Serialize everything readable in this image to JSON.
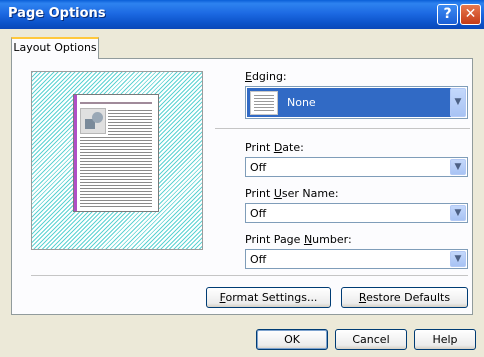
{
  "window": {
    "title": "Page Options",
    "help_glyph": "?",
    "close_glyph": "✕"
  },
  "tabs": [
    {
      "label": "Layout Options"
    }
  ],
  "edging": {
    "label_first": "E",
    "label_rest": "dging:",
    "value": "None"
  },
  "print_date": {
    "label_pre": "Print ",
    "label_key": "D",
    "label_rest": "ate:",
    "value": "Off"
  },
  "print_user_name": {
    "label_pre": "Print ",
    "label_key": "U",
    "label_rest": "ser Name:",
    "value": "Off"
  },
  "print_page_number": {
    "label_pre": "Print Page ",
    "label_key": "N",
    "label_rest": "umber:",
    "value": "Off"
  },
  "buttons": {
    "format_settings": {
      "key": "F",
      "rest": "ormat Settings..."
    },
    "restore_defaults": {
      "key": "R",
      "rest": "estore Defaults"
    },
    "ok": "OK",
    "cancel": "Cancel",
    "help": "Help"
  },
  "colors": {
    "titlebar": "#0a5fd8",
    "selection": "#316ac5",
    "hatch": "#5ed3d3",
    "gutter": "#b04fc7"
  },
  "icons": {
    "dropdown": "chevron-down-icon",
    "help": "help-icon",
    "close": "close-icon"
  }
}
